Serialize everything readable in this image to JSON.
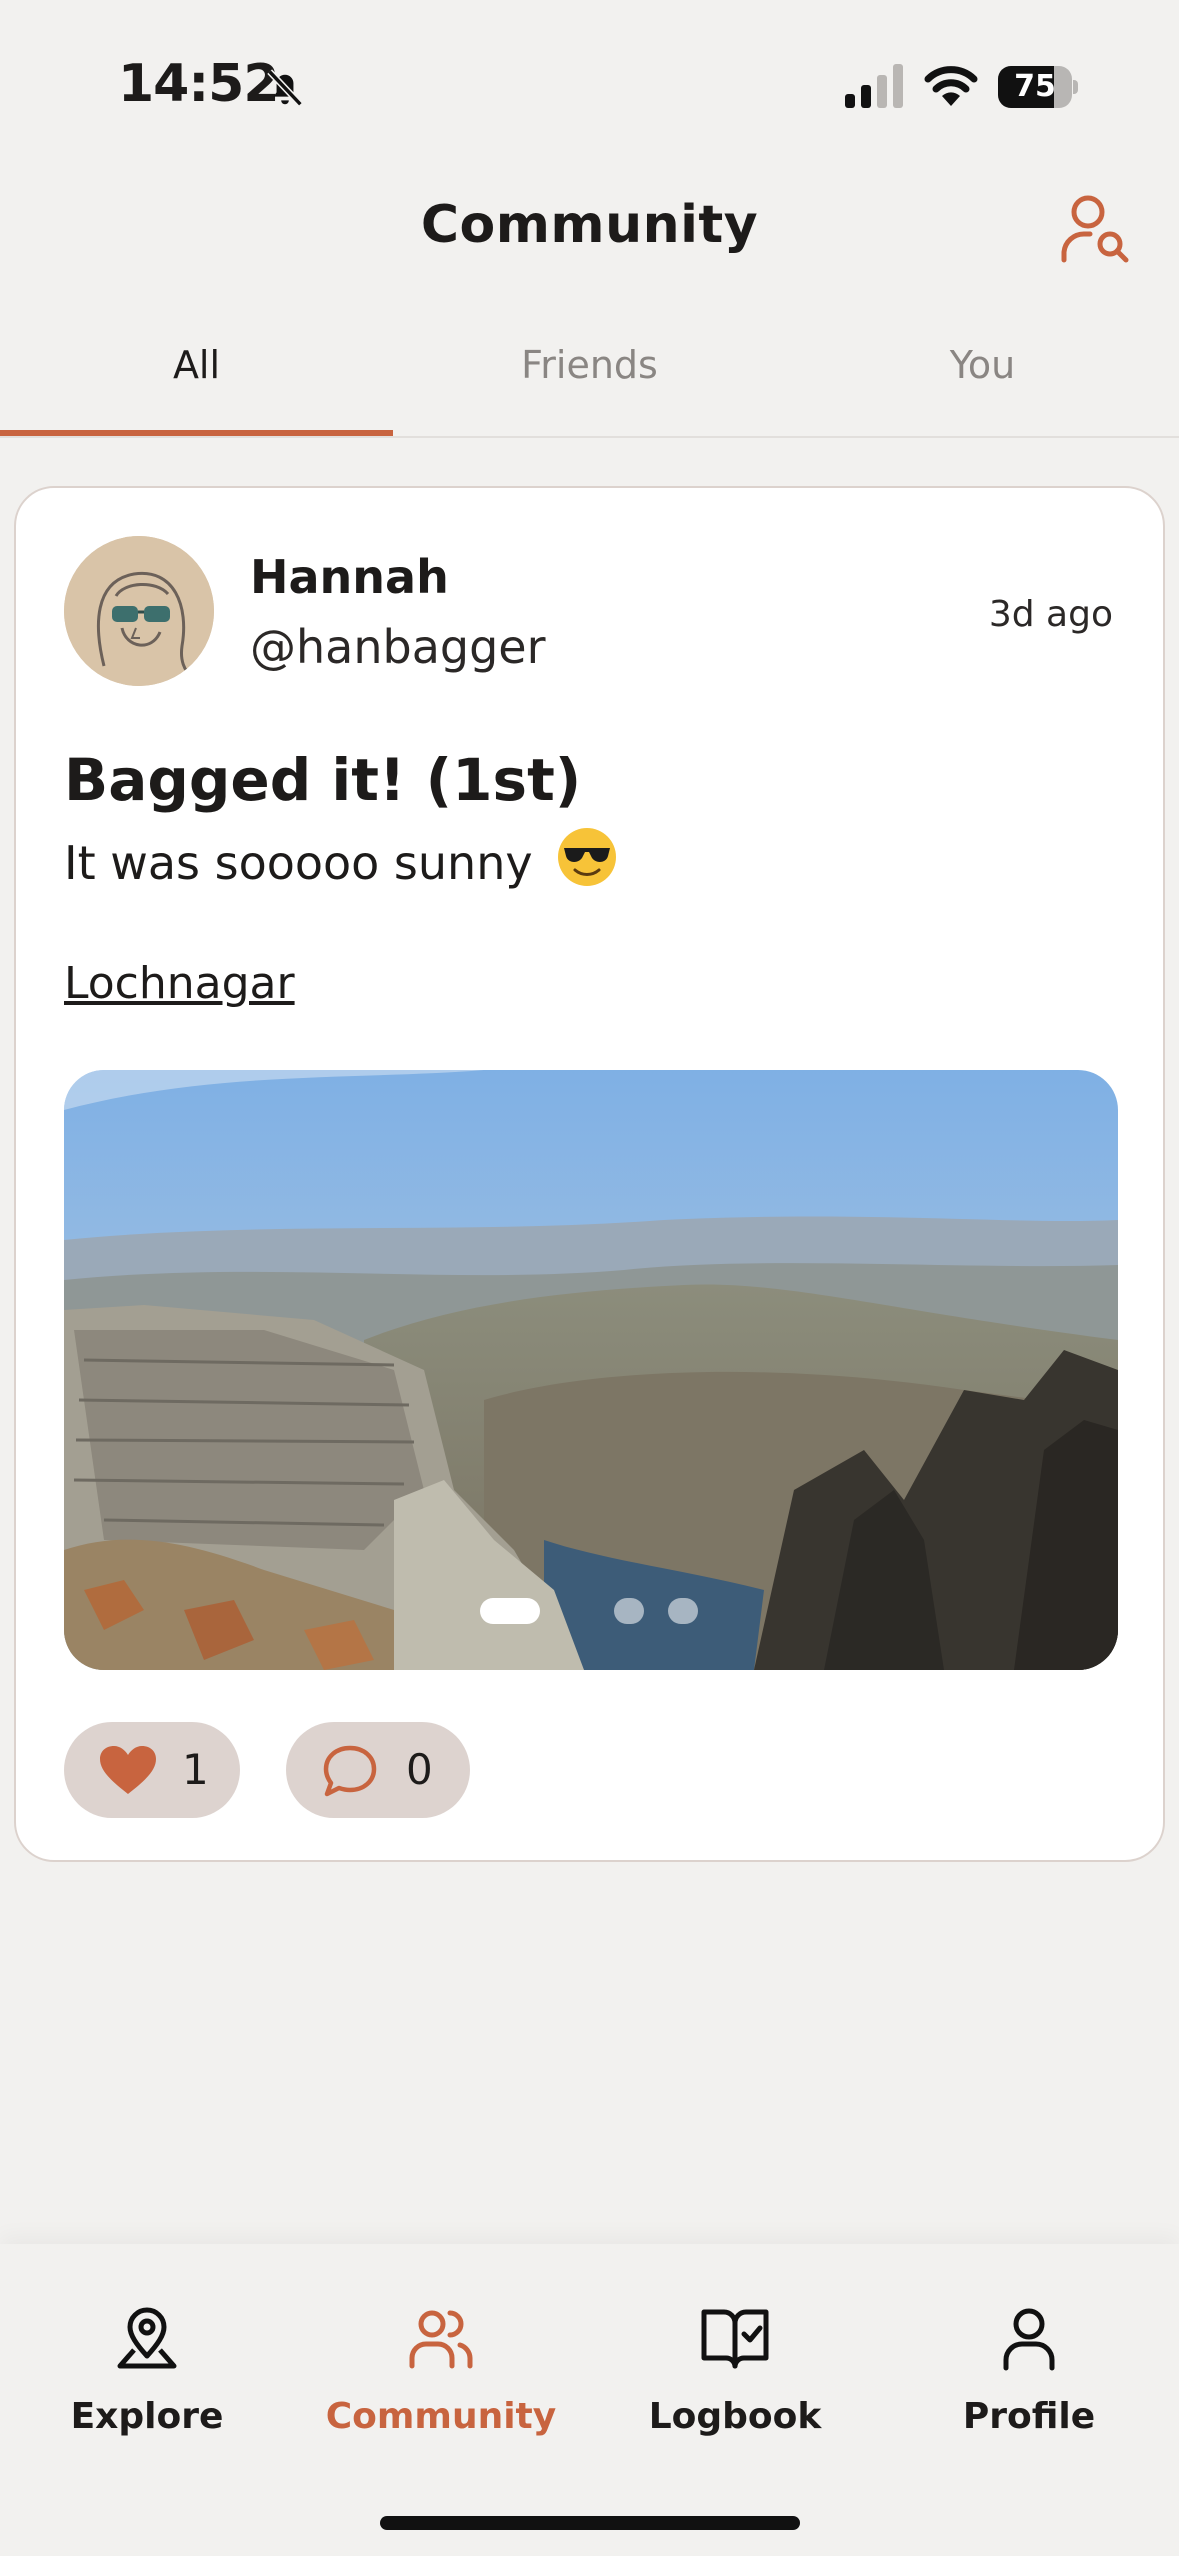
{
  "status_bar": {
    "time": "14:52",
    "battery": "75",
    "battery_level": 0.75
  },
  "header": {
    "title": "Community"
  },
  "tabs": [
    {
      "label": "All",
      "active": true
    },
    {
      "label": "Friends",
      "active": false
    },
    {
      "label": "You",
      "active": false
    }
  ],
  "post": {
    "author_name": "Hannah",
    "author_handle": "@hanbagger",
    "time": "3d ago",
    "title": "Bagged it! (1st)",
    "body": "It was sooooo sunny",
    "link": "Lochnagar",
    "photo_count": 3,
    "photo_index": 1,
    "likes": "1",
    "comments": "0"
  },
  "nav": [
    {
      "label": "Explore",
      "icon": "map-pin-icon",
      "active": false
    },
    {
      "label": "Community",
      "icon": "users-icon",
      "active": true
    },
    {
      "label": "Logbook",
      "icon": "book-check-icon",
      "active": false
    },
    {
      "label": "Profile",
      "icon": "user-icon",
      "active": false
    }
  ],
  "colors": {
    "accent": "#c8643f",
    "background": "#f2f1ef",
    "pill": "#ddd3cf"
  }
}
